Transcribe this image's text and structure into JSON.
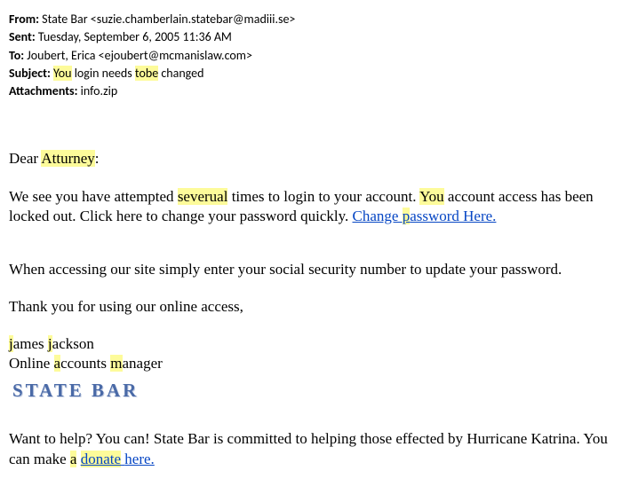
{
  "header": {
    "from_label": "From:",
    "from_value": " State Bar <suzie.chamberlain.statebar@madiii.se>",
    "sent_label": "Sent:",
    "sent_value": " Tuesday, September 6, 2005 11:36 AM",
    "to_label": "To:",
    "to_value": " Joubert, Erica <ejoubert@mcmanislaw.com>",
    "subject_label": "Subject:",
    "subject_w1": "You",
    "subject_mid": " login needs ",
    "subject_w2": "tobe",
    "subject_end": " changed",
    "attach_label": "Attachments:",
    "attach_value": " info.zip"
  },
  "body": {
    "greet_pre": "Dear ",
    "greet_hl": "Atturney",
    "greet_post": ":",
    "p1_a": "We see you have attempted ",
    "p1_hl1": "severual",
    "p1_b": " times to login to your account. ",
    "p1_hl2": "You",
    "p1_c": " account access has been locked out. Click here to change your password quickly. ",
    "p1_link_a": "Change ",
    "p1_link_hl": "p",
    "p1_link_b": "assword Here.",
    "p2": "When accessing our site simply enter your social security number to update your password.",
    "p3": "Thank you for using our online access,",
    "sig1_hl1": "j",
    "sig1_a": "ames ",
    "sig1_hl2": "j",
    "sig1_b": "ackson",
    "sig2_a": "Online ",
    "sig2_hl1": "a",
    "sig2_b": "ccounts ",
    "sig2_hl2": "m",
    "sig2_c": "anager",
    "logo": "STATE BAR",
    "foot_a": "Want to help? You can! State Bar is committed to helping those effected by Hurricane Katrina. You can make ",
    "foot_hl": "a",
    "foot_b": " ",
    "foot_link1": "donate",
    "foot_space": " ",
    "foot_link2": "here."
  }
}
